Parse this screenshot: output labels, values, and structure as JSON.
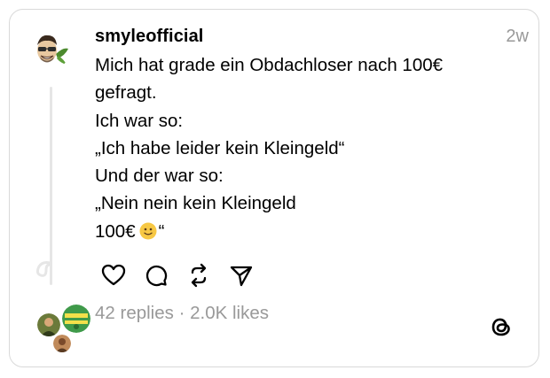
{
  "post": {
    "username": "smyleofficial",
    "timestamp": "2w",
    "lines": [
      "Mich hat grade ein Obdachloser nach 100€",
      "gefragt.",
      "Ich war so:",
      "„Ich habe leider kein Kleingeld“",
      "Und der war so:",
      "„Nein nein kein Kleingeld"
    ],
    "last_line_start": "100€",
    "last_line_end": "“",
    "emoji_icon": "slightly-smiling-face-emoji"
  },
  "actions": {
    "icons": [
      "heart-icon",
      "comment-icon",
      "repost-icon",
      "share-icon"
    ]
  },
  "stats": {
    "replies": "42 replies",
    "separator": "·",
    "likes": "2.0K likes"
  },
  "logo": "threads-logo-icon"
}
